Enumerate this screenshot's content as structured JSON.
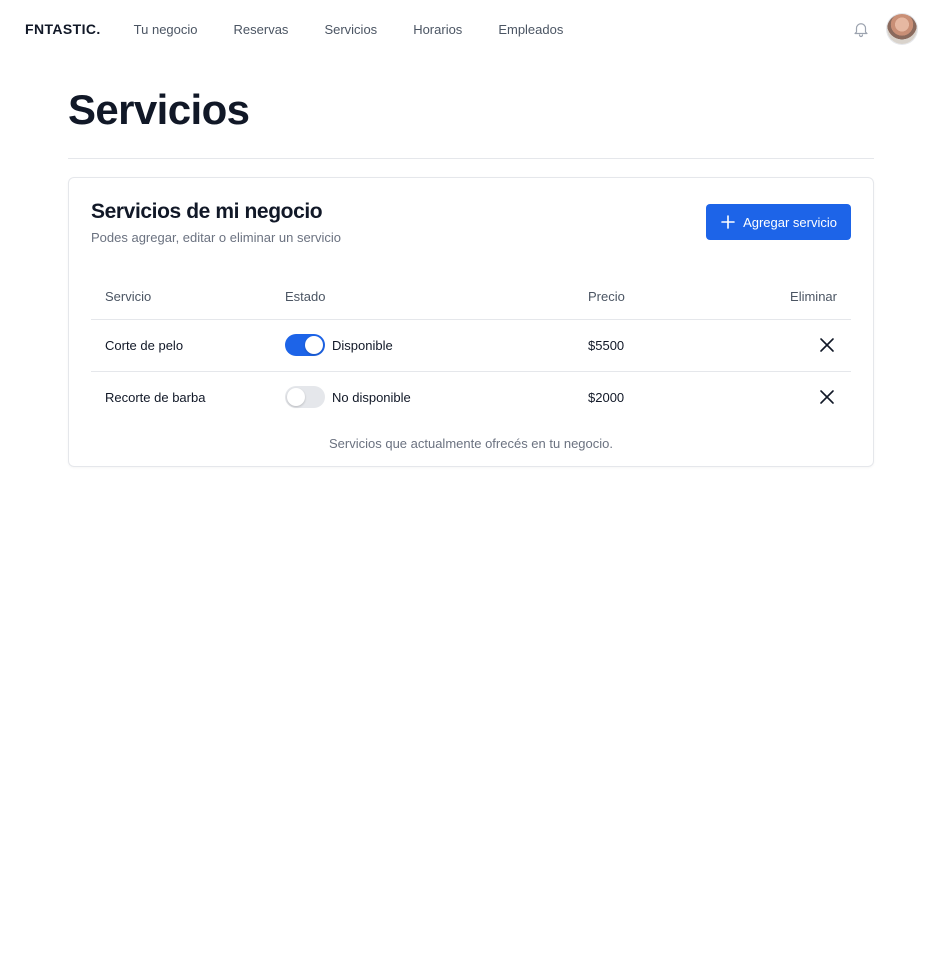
{
  "nav": {
    "brand": "FNTASTIC.",
    "links": [
      "Tu negocio",
      "Reservas",
      "Servicios",
      "Horarios",
      "Empleados"
    ],
    "bell_icon": "bell-icon",
    "avatar_icon": "user-avatar"
  },
  "page": {
    "title": "Servicios"
  },
  "card": {
    "title": "Servicios de mi negocio",
    "subtitle": "Podes agregar, editar o eliminar un servicio",
    "add_button_label": "Agregar servicio",
    "add_button_icon": "plus-icon",
    "accent_color": "#1d64e8"
  },
  "table": {
    "headers": {
      "service": "Servicio",
      "status": "Estado",
      "price": "Precio",
      "delete": "Eliminar"
    },
    "rows": [
      {
        "service": "Corte de pelo",
        "available": true,
        "status": "Disponible",
        "price": "$5500"
      },
      {
        "service": "Recorte de barba",
        "available": false,
        "status": "No disponible",
        "price": "$2000"
      }
    ],
    "caption": "Servicios que actualmente ofrecés en tu negocio."
  }
}
